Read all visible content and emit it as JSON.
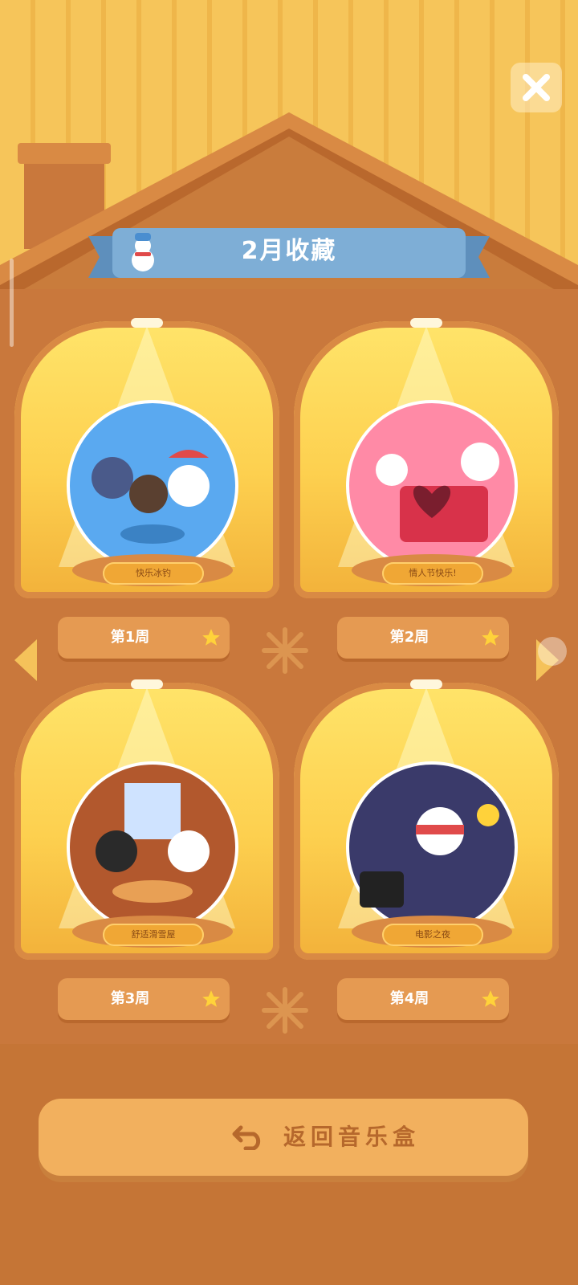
{
  "title": "2月收藏",
  "close_icon": "close-icon",
  "cells": [
    {
      "globe_label": "快乐冰钓",
      "week_label": "第1周",
      "globe_color": "#5aa9f0",
      "base_color": "#7cc8ff"
    },
    {
      "globe_label": "情人节快乐!",
      "week_label": "第2周",
      "globe_color": "#ff8aa6",
      "base_color": "#ffc1cf"
    },
    {
      "globe_label": "舒适滑雪屋",
      "week_label": "第3周",
      "globe_color": "#b2582d",
      "base_color": "#ffd5a0"
    },
    {
      "globe_label": "电影之夜",
      "week_label": "第4周",
      "globe_color": "#3a3a6a",
      "base_color": "#5a5a95"
    }
  ],
  "back_button": "返回音乐盒",
  "colors": {
    "accent": "#f0a735",
    "wood": "#c9783c",
    "ribbon": "#7eaed6"
  }
}
